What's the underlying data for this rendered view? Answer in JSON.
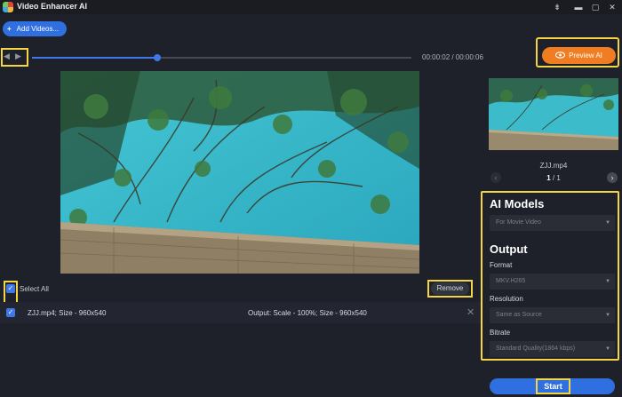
{
  "window": {
    "title": "Video Enhancer AI",
    "controls": {
      "pin": "⇟",
      "minimize": "▬",
      "maximize": "▢",
      "close": "✕"
    }
  },
  "toolbar": {
    "add_videos_icon": "+",
    "add_videos_label": "Add Videos...",
    "preview_icon": "eye-icon",
    "preview_label": "Preview AI"
  },
  "player": {
    "prev_frame_glyph": "◀",
    "next_frame_glyph": "▶",
    "timecode": "00:00:02 / 00:00:06",
    "progress_fraction": 0.33
  },
  "side": {
    "file_name": "ZJJ.mp4",
    "page_current": "1",
    "page_sep": " / ",
    "page_total": "1",
    "prev_glyph": "‹",
    "next_glyph": "›"
  },
  "settings": {
    "ai_models_title": "AI Models",
    "ai_model_value": "For Movie Video",
    "output_title": "Output",
    "format_label": "Format",
    "format_value": "MKV.H265",
    "resolution_label": "Resolution",
    "resolution_value": "Same as Source",
    "bitrate_label": "Bitrate",
    "bitrate_value": "Standard Quality(1864 kbps)",
    "caret": "▼"
  },
  "actions": {
    "start_label": "Start",
    "remove_label": "Remove",
    "select_all_label": "Select All",
    "check_glyph": "✓"
  },
  "list": {
    "rows": [
      {
        "file_info": "ZJJ.mp4; Size - 960x540",
        "output_info": "Output: Scale - 100%; Size - 960x540",
        "remove_glyph": "✕"
      }
    ]
  },
  "colors": {
    "accent_blue": "#2f6fe0",
    "accent_orange": "#f07d22",
    "highlight_yellow": "#f4d644",
    "background": "#1e2129"
  }
}
